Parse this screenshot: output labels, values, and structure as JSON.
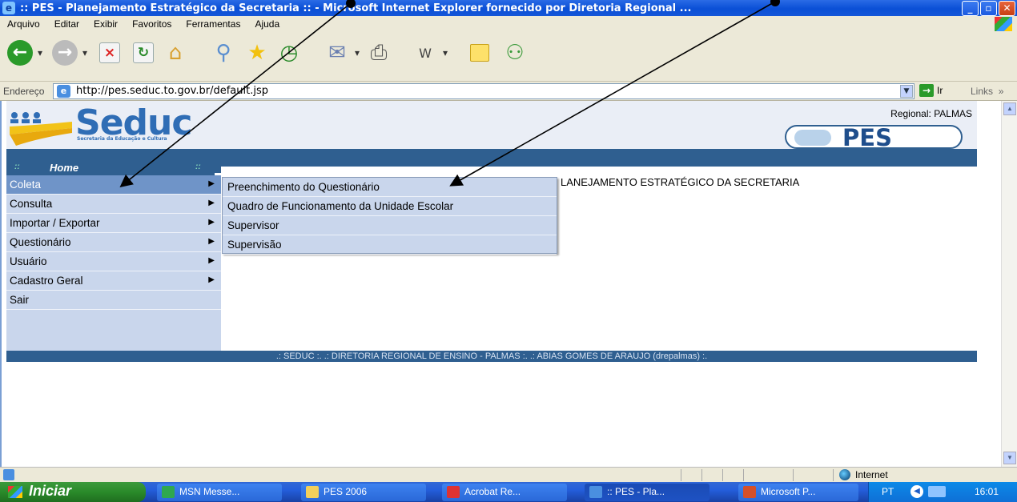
{
  "window": {
    "title": ":: PES - Planejamento Estratégico da Secretaria :: - Microsoft Internet Explorer fornecido por Diretoria Regional ...",
    "controls": {
      "minimize": "_",
      "maximize": "▫",
      "close": "✕"
    }
  },
  "menubar": {
    "items": [
      "Arquivo",
      "Editar",
      "Exibir",
      "Favoritos",
      "Ferramentas",
      "Ajuda"
    ]
  },
  "address": {
    "label": "Endereço",
    "url": "http://pes.seduc.to.gov.br/default.jsp",
    "go_label": "Ir",
    "links_label": "Links",
    "links_more": "»"
  },
  "page": {
    "logo_text": "Seduc",
    "logo_subtitle": "Secretaria da Educação e Cultura",
    "regional": "Regional: PALMAS",
    "pes_logo": "PES",
    "left_header": "Home",
    "left_header_dots": "::",
    "content_heading": "LANEJAMENTO ESTRATÉGICO DA SECRETARIA",
    "menu": [
      {
        "label": "Coleta",
        "has_submenu": true,
        "selected": true
      },
      {
        "label": "Consulta",
        "has_submenu": true
      },
      {
        "label": "Importar / Exportar",
        "has_submenu": true
      },
      {
        "label": "Questionário",
        "has_submenu": true
      },
      {
        "label": "Usuário",
        "has_submenu": true
      },
      {
        "label": "Cadastro Geral",
        "has_submenu": true
      },
      {
        "label": "Sair",
        "has_submenu": false
      }
    ],
    "submenu": [
      "Preenchimento do Questionário",
      "Quadro de Funcionamento da Unidade Escolar",
      "Supervisor",
      "Supervisão"
    ],
    "footer": ".: SEDUC :. .: DIRETORIA REGIONAL DE ENSINO - PALMAS :. .: ABIAS GOMES DE ARAUJO (drepalmas) :."
  },
  "statusbar": {
    "zone": "Internet"
  },
  "taskbar": {
    "start": "Iniciar",
    "tasks": [
      "MSN Messe...",
      "PES 2006",
      "Acrobat Re...",
      ":: PES - Pla...",
      "Microsoft P..."
    ],
    "lang": "PT",
    "clock": "16:01"
  },
  "colors": {
    "header_band": "#2f5f90",
    "menu_bg": "#c9d6ec",
    "menu_selected": "#6f94c8",
    "titlebar": "#0a4fd6",
    "taskbar": "#245edb",
    "start_button": "#2a8a2a"
  }
}
